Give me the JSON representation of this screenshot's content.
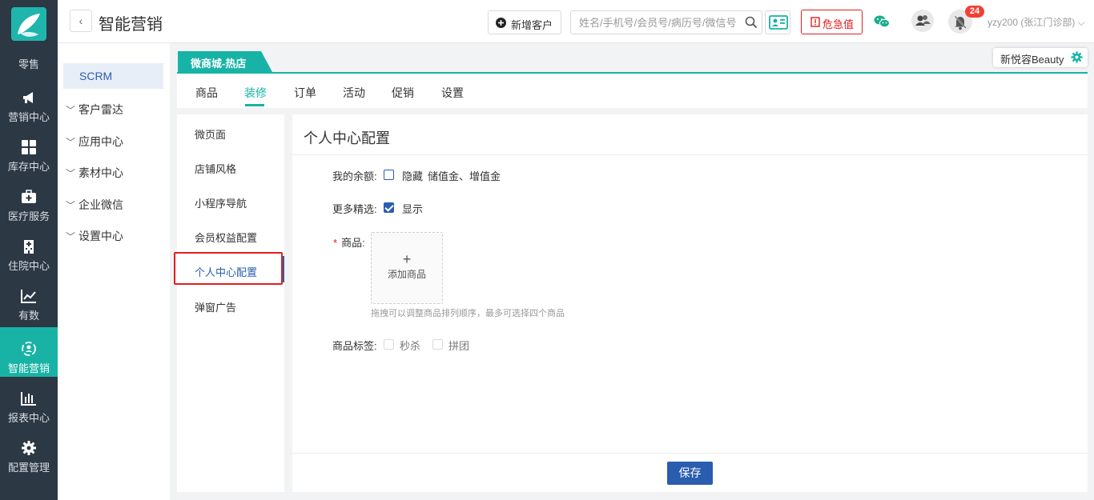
{
  "leftnav": {
    "items": [
      {
        "label": "零售"
      },
      {
        "label": "营销中心"
      },
      {
        "label": "库存中心"
      },
      {
        "label": "医疗服务"
      },
      {
        "label": "住院中心"
      },
      {
        "label": "有数"
      },
      {
        "label": "智能营销"
      },
      {
        "label": "报表中心"
      },
      {
        "label": "配置管理"
      }
    ],
    "active": "智能营销"
  },
  "header": {
    "back_icon": "‹",
    "title": "智能营销",
    "add_customer": "新增客户",
    "search_placeholder": "姓名/手机号/会员号/病历号/微信号",
    "critical": "危急值",
    "notifications": "24",
    "user": "yzy200 (张江门诊部) ⌵",
    "accent": "#16b3a6"
  },
  "subnav": {
    "active": "SCRM",
    "items": [
      {
        "label": "客户雷达"
      },
      {
        "label": "应用中心"
      },
      {
        "label": "素材中心"
      },
      {
        "label": "企业微信"
      },
      {
        "label": "设置中心"
      }
    ]
  },
  "store": {
    "tab": "微商城-热店",
    "brand": "新悦容Beauty"
  },
  "tabs": [
    {
      "label": "商品"
    },
    {
      "label": "装修"
    },
    {
      "label": "订单"
    },
    {
      "label": "活动"
    },
    {
      "label": "促销"
    },
    {
      "label": "设置"
    }
  ],
  "active_tab": "装修",
  "decor_menu": [
    {
      "label": "微页面"
    },
    {
      "label": "店铺风格"
    },
    {
      "label": "小程序导航"
    },
    {
      "label": "会员权益配置"
    },
    {
      "label": "个人中心配置"
    },
    {
      "label": "弹窗广告"
    }
  ],
  "decor_active": "个人中心配置",
  "panel": {
    "title": "个人中心配置",
    "balance_label": "我的余额:",
    "balance_option": "隐藏",
    "balance_detail": "储值金、增值金",
    "balance_checked": false,
    "more_label": "更多精选:",
    "more_option": "显示",
    "more_checked": true,
    "product_required": "*",
    "product_label": "商品:",
    "add_product_plus": "+",
    "add_product": "添加商品",
    "hint": "拖拽可以调整商品排列顺序，最多可选择四个商品",
    "tag_label": "商品标签:",
    "tag_options": [
      {
        "label": "秒杀",
        "checked": false
      },
      {
        "label": "拼团",
        "checked": false
      }
    ],
    "save": "保存"
  }
}
